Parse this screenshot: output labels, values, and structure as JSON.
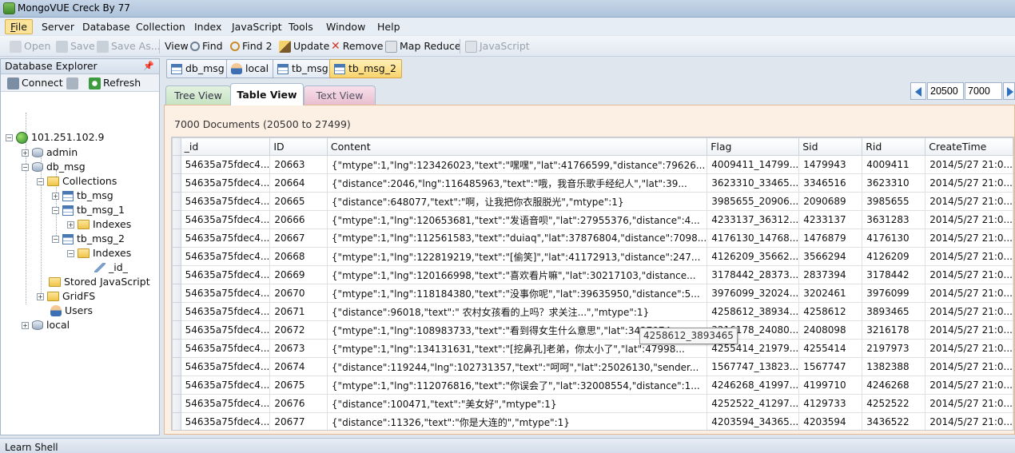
{
  "window": {
    "title": "MongoVUE Creck By 77"
  },
  "menu": [
    "File",
    "Server",
    "Database",
    "Collection",
    "Index",
    "JavaScript",
    "Tools",
    "Window",
    "Help"
  ],
  "menu_hotkeys": [
    "F",
    "S",
    "D",
    "C",
    "I",
    "J",
    "T",
    "W",
    "H"
  ],
  "toolbar": {
    "open": "Open",
    "save": "Save",
    "save_as": "Save As...",
    "view": "View",
    "find": "Find",
    "find2": "Find 2",
    "update": "Update",
    "remove": "Remove",
    "map_reduce": "Map Reduce",
    "javascript": "JavaScript"
  },
  "explorer": {
    "title": "Database Explorer",
    "connect": "Connect",
    "refresh": "Refresh",
    "tree": {
      "server": "101.251.102.9",
      "admin": "admin",
      "db_msg": "db_msg",
      "collections": "Collections",
      "tb_msg": "tb_msg",
      "tb_msg_1": "tb_msg_1",
      "indexes_1": "Indexes",
      "tb_msg_2": "tb_msg_2",
      "indexes_2": "Indexes",
      "id_index": "_id_",
      "stored_js": "Stored JavaScript",
      "gridfs": "GridFS",
      "users": "Users",
      "local": "local"
    }
  },
  "doc_tabs": [
    "db_msg",
    "local",
    "tb_msg",
    "tb_msg_2"
  ],
  "view_tabs": {
    "tree": "Tree View",
    "table": "Table View",
    "text": "Text View"
  },
  "pager": {
    "skip": "20500",
    "limit": "7000"
  },
  "grid": {
    "count_label": "7000 Documents (20500 to 27499)",
    "columns": [
      "_id",
      "ID",
      "Content",
      "Flag",
      "Sid",
      "Rid",
      "CreateTime"
    ],
    "rows": [
      [
        "54635a75fdec4...",
        "20663",
        "{\"mtype\":1,\"lng\":123426023,\"text\":\"嘿嘿\",\"lat\":41766599,\"distance\":79626...",
        "4009411_14799...",
        "1479943",
        "4009411",
        "2014/5/27 21:0..."
      ],
      [
        "54635a75fdec4...",
        "20664",
        "{\"distance\":2046,\"lng\":116485963,\"text\":\"哦，我音乐歌手经纪人\",\"lat\":39...",
        "3623310_33465...",
        "3346516",
        "3623310",
        "2014/5/27 21:0..."
      ],
      [
        "54635a75fdec4...",
        "20665",
        "{\"distance\":648077,\"text\":\"啊，让我把你衣服脱光\",\"mtype\":1}",
        "3985655_20906...",
        "2090689",
        "3985655",
        "2014/5/27 21:0..."
      ],
      [
        "54635a75fdec4...",
        "20666",
        "{\"mtype\":1,\"lng\":120653681,\"text\":\"发语音呗\",\"lat\":27955376,\"distance\":4...",
        "4233137_36312...",
        "4233137",
        "3631283",
        "2014/5/27 21:0..."
      ],
      [
        "54635a75fdec4...",
        "20667",
        "{\"mtype\":1,\"lng\":112561583,\"text\":\"duiaq\",\"lat\":37876804,\"distance\":7098...",
        "4176130_14768...",
        "1476879",
        "4176130",
        "2014/5/27 21:0..."
      ],
      [
        "54635a75fdec4...",
        "20668",
        "{\"mtype\":1,\"lng\":122819219,\"text\":\"[偷笑]\",\"lat\":41172913,\"distance\":247...",
        "4126209_35662...",
        "3566294",
        "4126209",
        "2014/5/27 21:0..."
      ],
      [
        "54635a75fdec4...",
        "20669",
        "{\"mtype\":1,\"lng\":120166998,\"text\":\"喜欢看片嘛\",\"lat\":30217103,\"distance...",
        "3178442_28373...",
        "2837394",
        "3178442",
        "2014/5/27 21:0..."
      ],
      [
        "54635a75fdec4...",
        "20670",
        "{\"mtype\":1,\"lng\":118184380,\"text\":\"没事你呢\",\"lat\":39635950,\"distance\":5...",
        "3976099_32024...",
        "3202461",
        "3976099",
        "2014/5/27 21:0..."
      ],
      [
        "54635a75fdec4...",
        "20671",
        "{\"distance\":96018,\"text\":\" 农村女孩看的上吗？求关注...\",\"mtype\":1}",
        "4258612_38934...",
        "4258612",
        "3893465",
        "2014/5/27 21:0..."
      ],
      [
        "54635a75fdec4...",
        "20672",
        "{\"mtype\":1,\"lng\":108983733,\"text\":\"看到得女生什么意思\",\"lat\":3427074",
        "3216178_24080...",
        "2408098",
        "3216178",
        "2014/5/27 21:0..."
      ],
      [
        "54635a75fdec4...",
        "20673",
        "{\"mtype\":1,\"lng\":134131631,\"text\":\"[挖鼻孔]老弟，你太小了\",\"lat\":47998...",
        "4255414_21979...",
        "4255414",
        "2197973",
        "2014/5/27 21:0..."
      ],
      [
        "54635a75fdec4...",
        "20674",
        "{\"distance\":119244,\"lng\":102731357,\"text\":\"呵呵\",\"lat\":25026130,\"sender...",
        "1567747_13823...",
        "1567747",
        "1382388",
        "2014/5/27 21:0..."
      ],
      [
        "54635a75fdec4...",
        "20675",
        "{\"mtype\":1,\"lng\":112076816,\"text\":\"你误会了\",\"lat\":32008554,\"distance\":1...",
        "4246268_41997...",
        "4199710",
        "4246268",
        "2014/5/27 21:0..."
      ],
      [
        "54635a75fdec4...",
        "20676",
        "{\"distance\":100471,\"text\":\"美女好\",\"mtype\":1}",
        "4252522_41297...",
        "4129733",
        "4252522",
        "2014/5/27 21:0..."
      ],
      [
        "54635a75fdec4...",
        "20677",
        "{\"distance\":11326,\"text\":\"你是大连的\",\"mtype\":1}",
        "4203594_34365...",
        "4203594",
        "3436522",
        "2014/5/27 21:0..."
      ]
    ]
  },
  "tooltip": "4258612_3893465",
  "status": {
    "text": "Learn Shell"
  },
  "colors": {
    "accent": "#f9d36b",
    "grid_panel": "#fcefe3",
    "titlebar": "#aec3dc"
  }
}
